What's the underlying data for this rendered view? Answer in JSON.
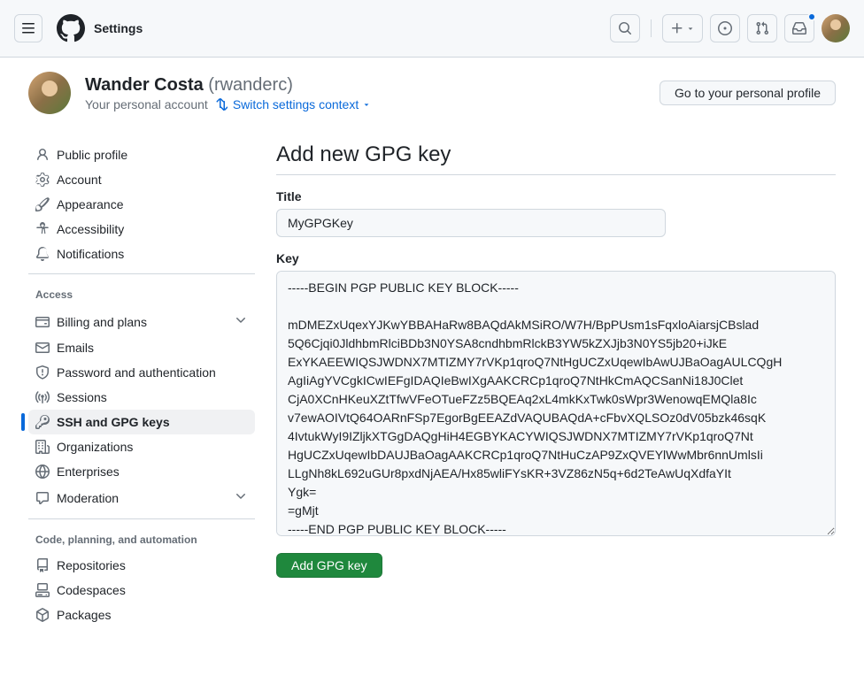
{
  "topbar": {
    "title": "Settings"
  },
  "user": {
    "name": "Wander Costa",
    "handle": "(rwanderc)",
    "subtitle": "Your personal account",
    "switch_link": "Switch settings context",
    "profile_button": "Go to your personal profile"
  },
  "sidebar": {
    "top": [
      {
        "label": "Public profile",
        "icon": "person"
      },
      {
        "label": "Account",
        "icon": "gear"
      },
      {
        "label": "Appearance",
        "icon": "brush"
      },
      {
        "label": "Accessibility",
        "icon": "accessibility"
      },
      {
        "label": "Notifications",
        "icon": "bell"
      }
    ],
    "access_title": "Access",
    "access": [
      {
        "label": "Billing and plans",
        "icon": "credit-card",
        "expandable": true
      },
      {
        "label": "Emails",
        "icon": "mail"
      },
      {
        "label": "Password and authentication",
        "icon": "shield"
      },
      {
        "label": "Sessions",
        "icon": "broadcast"
      },
      {
        "label": "SSH and GPG keys",
        "icon": "key",
        "active": true
      },
      {
        "label": "Organizations",
        "icon": "org"
      },
      {
        "label": "Enterprises",
        "icon": "globe"
      },
      {
        "label": "Moderation",
        "icon": "comment",
        "expandable": true
      }
    ],
    "code_title": "Code, planning, and automation",
    "code": [
      {
        "label": "Repositories",
        "icon": "repo"
      },
      {
        "label": "Codespaces",
        "icon": "codespaces"
      },
      {
        "label": "Packages",
        "icon": "package"
      }
    ]
  },
  "main": {
    "title": "Add new GPG key",
    "title_label": "Title",
    "title_value": "MyGPGKey",
    "key_label": "Key",
    "key_value": "-----BEGIN PGP PUBLIC KEY BLOCK-----\n\nmDMEZxUqexYJKwYBBAHaRw8BAQdAkMSiRO/W7H/BpPUsm1sFqxloAiarsjCBslad\n5Q6Cjqi0JldhbmRlciBDb3N0YSA8cndhbmRlckB3YW5kZXJjb3N0YS5jb20+iJkE\nExYKAEEWIQSJWDNX7MTIZMY7rVKp1qroQ7NtHgUCZxUqewIbAwUJBaOagAULCQgH\nAgIiAgYVCgkICwIEFgIDAQIeBwIXgAAKCRCp1qroQ7NtHkCmAQCSanNi18J0Clet\nCjA0XCnHKeuXZtTfwVFeOTueFZz5BQEAq2xL4mkKxTwk0sWpr3WenowqEMQla8Ic\nv7ewAOIVtQ64OARnFSp7EgorBgEEAZdVAQUBAQdA+cFbvXQLSOz0dV05bzk46sqK\n4IvtukWyI9IZljkXTGgDAQgHiH4EGBYKACYWIQSJWDNX7MTIZMY7rVKp1qroQ7Nt\nHgUCZxUqewIbDAUJBaOagAAKCRCp1qroQ7NtHuCzAP9ZxQVEYlWwMbr6nnUmlsIi\nLLgNh8kL692uGUr8pxdNjAEA/Hx85wliFYsKR+3VZ86zN5q+6d2TeAwUqXdfaYIt\nYgk=\n=gMjt\n-----END PGP PUBLIC KEY BLOCK-----",
    "submit_label": "Add GPG key"
  }
}
